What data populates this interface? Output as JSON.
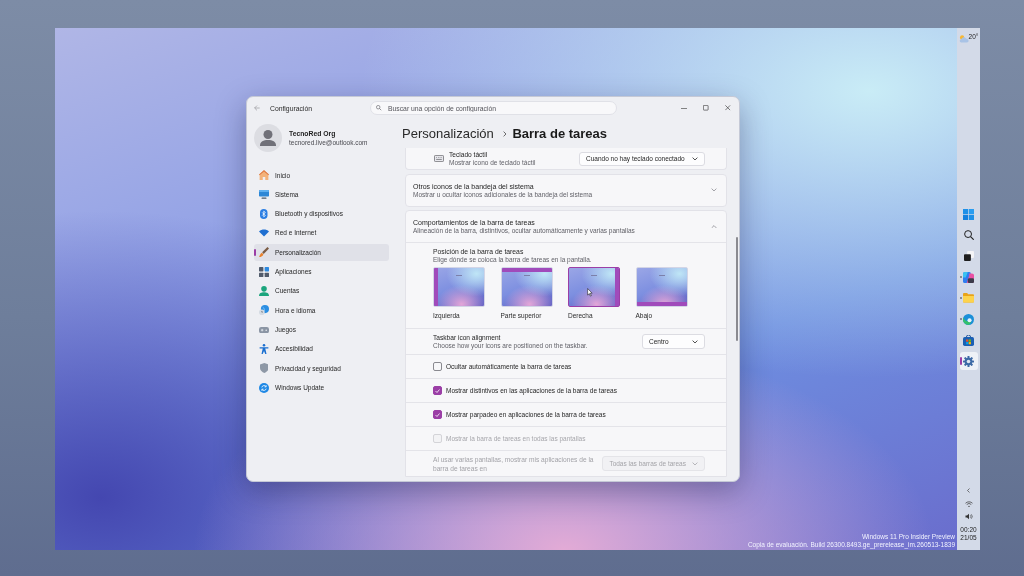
{
  "desktop": {
    "evaluation_notice": [
      "Windows 11 Pro Insider Preview",
      "Copia de evaluación. Build 26300.8493.ge_prerelease_im.260513-1839"
    ]
  },
  "window": {
    "title": "Configuración",
    "search": {
      "placeholder": "Buscar una opción de configuración"
    }
  },
  "account": {
    "name": "TecnoRed Org",
    "email": "tecnored.live@outlook.com"
  },
  "sidebar": {
    "items": [
      {
        "label": "Inicio",
        "selected": false
      },
      {
        "label": "Sistema",
        "selected": false
      },
      {
        "label": "Bluetooth y dispositivos",
        "selected": false
      },
      {
        "label": "Red e Internet",
        "selected": false
      },
      {
        "label": "Personalización",
        "selected": true
      },
      {
        "label": "Aplicaciones",
        "selected": false
      },
      {
        "label": "Cuentas",
        "selected": false
      },
      {
        "label": "Hora e idioma",
        "selected": false
      },
      {
        "label": "Juegos",
        "selected": false
      },
      {
        "label": "Accesibilidad",
        "selected": false
      },
      {
        "label": "Privacidad y seguridad",
        "selected": false
      },
      {
        "label": "Windows Update",
        "selected": false
      }
    ]
  },
  "breadcrumb": {
    "parent": "Personalización",
    "current": "Barra de tareas"
  },
  "settings": [
    {
      "kind": "dropdown",
      "title": "Teclado táctil",
      "description": "Mostrar icono de teclado táctil",
      "value": "Cuando no hay teclado conectado",
      "disabled": false
    },
    {
      "kind": "expander",
      "title": "Otros iconos de la bandeja del sistema",
      "description": "Mostrar u ocultar iconos adicionales de la bandeja del sistema",
      "expanded": false
    },
    {
      "kind": "expander",
      "title": "Comportamientos de la barra de tareas",
      "description": "Alineación de la barra, distintivos, ocultar automáticamente y varias pantallas",
      "expanded": true,
      "children": [
        {
          "kind": "position",
          "title": "Posición de la barra de tareas",
          "description": "Elige dónde se coloca la barra de tareas en la pantalla.",
          "options": [
            {
              "label": "Izquierda",
              "selected": false
            },
            {
              "label": "Parte superior",
              "selected": false
            },
            {
              "label": "Derecha",
              "selected": true
            },
            {
              "label": "Abajo",
              "selected": false
            }
          ]
        },
        {
          "kind": "dropdown",
          "title": "Taskbar icon alignment",
          "description": "Choose how your icons are positioned on the taskbar.",
          "value": "Centro",
          "disabled": false
        },
        {
          "kind": "checkbox",
          "label": "Ocultar automáticamente la barra de tareas",
          "checked": false,
          "disabled": false
        },
        {
          "kind": "checkbox",
          "label": "Mostrar distintivos en las aplicaciones de la barra de tareas",
          "checked": true,
          "disabled": false
        },
        {
          "kind": "checkbox",
          "label": "Mostrar parpadeo en aplicaciones de la barra de tareas",
          "checked": true,
          "disabled": false
        },
        {
          "kind": "checkbox",
          "label": "Mostrar la barra de tareas en todas las pantallas",
          "checked": false,
          "disabled": true
        },
        {
          "kind": "dropdown",
          "title": "Al usar varias pantallas, mostrar mis aplicaciones de la barra de tareas en",
          "value": "Todas las barras de tareas",
          "disabled": true
        }
      ]
    }
  ],
  "taskbar": {
    "temperature": "20°",
    "apps": [
      {
        "running": false,
        "selected": false
      },
      {
        "running": false,
        "selected": false
      },
      {
        "running": false,
        "selected": false
      },
      {
        "running": true,
        "selected": false
      },
      {
        "running": true,
        "selected": false
      },
      {
        "running": true,
        "selected": false
      },
      {
        "running": false,
        "selected": false
      },
      {
        "running": true,
        "selected": true
      }
    ],
    "clock": {
      "time": "00:20",
      "date": "21/05"
    }
  }
}
